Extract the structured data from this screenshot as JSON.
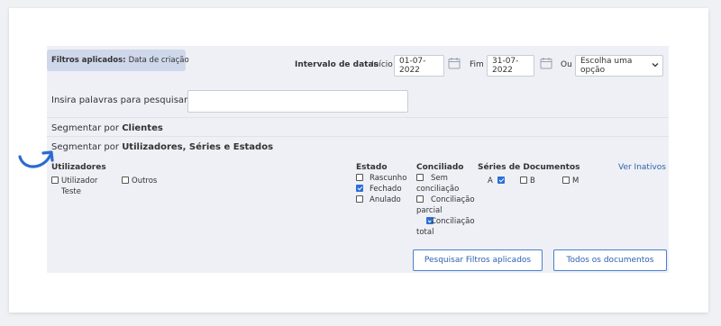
{
  "filters": {
    "label": "Filtros aplicados:",
    "value": "Data de criação"
  },
  "date_range": {
    "label": "Intervalo de datas",
    "start_label": "Início",
    "start_value": "01-07-2022",
    "end_label": "Fim",
    "end_value": "31-07-2022",
    "or_label": "Ou",
    "select_value": "Escolha uma opção"
  },
  "search": {
    "label": "Insira palavras para pesquisar",
    "value": ""
  },
  "segments": {
    "clients_prefix": "Segmentar por",
    "clients_bold": "Clientes",
    "users_prefix": "Segmentar por",
    "users_bold": "Utilizadores, Séries e Estados"
  },
  "users": {
    "header": "Utilizadores",
    "items": [
      {
        "label": "Utilizador Teste",
        "line1": "Utilizador",
        "line2": "Teste",
        "checked": false
      },
      {
        "label": "Outros",
        "checked": false
      }
    ]
  },
  "state": {
    "header": "Estado",
    "items": [
      {
        "label": "Rascunho",
        "checked": false
      },
      {
        "label": "Fechado",
        "checked": true
      },
      {
        "label": "Anulado",
        "checked": false
      }
    ]
  },
  "reconciled": {
    "header": "Conciliado",
    "items": [
      {
        "line1": "Sem",
        "line2": "conciliação",
        "checked": false
      },
      {
        "line1": "Conciliação",
        "line2": "parcial",
        "checked": false
      },
      {
        "line1": "Conciliação",
        "line2": "total",
        "checked": true
      }
    ]
  },
  "series": {
    "header": "Séries de Documentos",
    "link": "Ver Inativos",
    "items": [
      {
        "label": "A",
        "checked": true
      },
      {
        "label": "B",
        "checked": false
      },
      {
        "label": "M",
        "checked": false
      }
    ]
  },
  "actions": {
    "search_button": "Pesquisar Filtros aplicados",
    "all_docs_button": "Todos os documentos"
  },
  "colors": {
    "accent": "#2b6fd6",
    "panel": "#eef0f6",
    "badge": "#cfd8ea",
    "pointer_arrow": "#2a6bd1"
  },
  "icons": {
    "calendar": "calendar-icon",
    "dropdown": "chevron-down-icon",
    "annotation": "curved-arrow-icon"
  }
}
